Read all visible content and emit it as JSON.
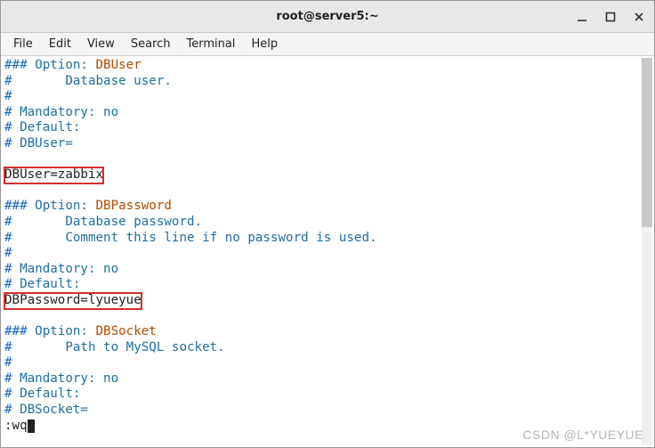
{
  "window": {
    "title": "root@server5:~"
  },
  "menubar": {
    "items": [
      "File",
      "Edit",
      "View",
      "Search",
      "Terminal",
      "Help"
    ]
  },
  "terminal": {
    "lines": [
      {
        "kind": "comment-opt",
        "hash": "###",
        "text": " Option: ",
        "opt": "DBUser"
      },
      {
        "kind": "comment",
        "hash": "#",
        "text": "       Database user."
      },
      {
        "kind": "comment",
        "hash": "#",
        "text": ""
      },
      {
        "kind": "comment",
        "hash": "#",
        "text": " Mandatory: no"
      },
      {
        "kind": "comment",
        "hash": "#",
        "text": " Default:"
      },
      {
        "kind": "comment",
        "hash": "#",
        "text": " DBUser="
      },
      {
        "kind": "blank"
      },
      {
        "kind": "assign-boxed",
        "text": "DBUser=zabbix"
      },
      {
        "kind": "blank"
      },
      {
        "kind": "comment-opt",
        "hash": "###",
        "text": " Option: ",
        "opt": "DBPassword"
      },
      {
        "kind": "comment",
        "hash": "#",
        "text": "       Database password."
      },
      {
        "kind": "comment",
        "hash": "#",
        "text": "       Comment this line if no password is used."
      },
      {
        "kind": "comment",
        "hash": "#",
        "text": ""
      },
      {
        "kind": "comment",
        "hash": "#",
        "text": " Mandatory: no"
      },
      {
        "kind": "comment",
        "hash": "#",
        "text": " Default:"
      },
      {
        "kind": "assign-boxed",
        "text": "DBPassword=lyueyue"
      },
      {
        "kind": "blank"
      },
      {
        "kind": "comment-opt",
        "hash": "###",
        "text": " Option: ",
        "opt": "DBSocket"
      },
      {
        "kind": "comment",
        "hash": "#",
        "text": "       Path to MySQL socket."
      },
      {
        "kind": "comment",
        "hash": "#",
        "text": ""
      },
      {
        "kind": "comment",
        "hash": "#",
        "text": " Mandatory: no"
      },
      {
        "kind": "comment",
        "hash": "#",
        "text": " Default:"
      },
      {
        "kind": "comment",
        "hash": "#",
        "text": " DBSocket="
      }
    ],
    "command": ":wq"
  },
  "watermark": "CSDN @L*YUEYUE"
}
